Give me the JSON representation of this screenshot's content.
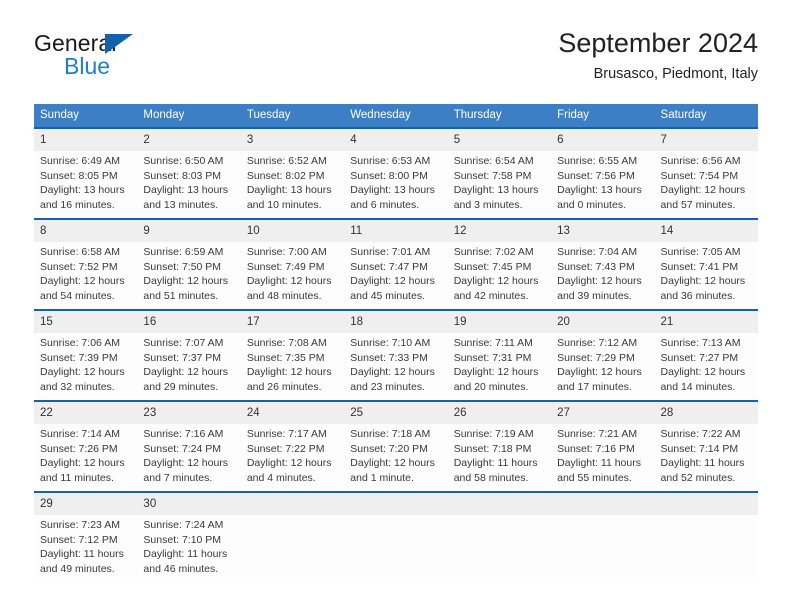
{
  "brand": {
    "name_part1": "General",
    "name_part2": "Blue",
    "triangle_color": "#1263ac",
    "blue_color": "#1a7fd4"
  },
  "header": {
    "title": "September 2024",
    "location": "Brusasco, Piedmont, Italy"
  },
  "theme": {
    "header_row_bg": "#3c7fc4",
    "week_divider": "#1263ac",
    "daynum_bg": "#efefef"
  },
  "weekdays": [
    "Sunday",
    "Monday",
    "Tuesday",
    "Wednesday",
    "Thursday",
    "Friday",
    "Saturday"
  ],
  "weeks": [
    [
      {
        "day": "1",
        "sunrise": "Sunrise: 6:49 AM",
        "sunset": "Sunset: 8:05 PM",
        "daylight1": "Daylight: 13 hours",
        "daylight2": "and 16 minutes."
      },
      {
        "day": "2",
        "sunrise": "Sunrise: 6:50 AM",
        "sunset": "Sunset: 8:03 PM",
        "daylight1": "Daylight: 13 hours",
        "daylight2": "and 13 minutes."
      },
      {
        "day": "3",
        "sunrise": "Sunrise: 6:52 AM",
        "sunset": "Sunset: 8:02 PM",
        "daylight1": "Daylight: 13 hours",
        "daylight2": "and 10 minutes."
      },
      {
        "day": "4",
        "sunrise": "Sunrise: 6:53 AM",
        "sunset": "Sunset: 8:00 PM",
        "daylight1": "Daylight: 13 hours",
        "daylight2": "and 6 minutes."
      },
      {
        "day": "5",
        "sunrise": "Sunrise: 6:54 AM",
        "sunset": "Sunset: 7:58 PM",
        "daylight1": "Daylight: 13 hours",
        "daylight2": "and 3 minutes."
      },
      {
        "day": "6",
        "sunrise": "Sunrise: 6:55 AM",
        "sunset": "Sunset: 7:56 PM",
        "daylight1": "Daylight: 13 hours",
        "daylight2": "and 0 minutes."
      },
      {
        "day": "7",
        "sunrise": "Sunrise: 6:56 AM",
        "sunset": "Sunset: 7:54 PM",
        "daylight1": "Daylight: 12 hours",
        "daylight2": "and 57 minutes."
      }
    ],
    [
      {
        "day": "8",
        "sunrise": "Sunrise: 6:58 AM",
        "sunset": "Sunset: 7:52 PM",
        "daylight1": "Daylight: 12 hours",
        "daylight2": "and 54 minutes."
      },
      {
        "day": "9",
        "sunrise": "Sunrise: 6:59 AM",
        "sunset": "Sunset: 7:50 PM",
        "daylight1": "Daylight: 12 hours",
        "daylight2": "and 51 minutes."
      },
      {
        "day": "10",
        "sunrise": "Sunrise: 7:00 AM",
        "sunset": "Sunset: 7:49 PM",
        "daylight1": "Daylight: 12 hours",
        "daylight2": "and 48 minutes."
      },
      {
        "day": "11",
        "sunrise": "Sunrise: 7:01 AM",
        "sunset": "Sunset: 7:47 PM",
        "daylight1": "Daylight: 12 hours",
        "daylight2": "and 45 minutes."
      },
      {
        "day": "12",
        "sunrise": "Sunrise: 7:02 AM",
        "sunset": "Sunset: 7:45 PM",
        "daylight1": "Daylight: 12 hours",
        "daylight2": "and 42 minutes."
      },
      {
        "day": "13",
        "sunrise": "Sunrise: 7:04 AM",
        "sunset": "Sunset: 7:43 PM",
        "daylight1": "Daylight: 12 hours",
        "daylight2": "and 39 minutes."
      },
      {
        "day": "14",
        "sunrise": "Sunrise: 7:05 AM",
        "sunset": "Sunset: 7:41 PM",
        "daylight1": "Daylight: 12 hours",
        "daylight2": "and 36 minutes."
      }
    ],
    [
      {
        "day": "15",
        "sunrise": "Sunrise: 7:06 AM",
        "sunset": "Sunset: 7:39 PM",
        "daylight1": "Daylight: 12 hours",
        "daylight2": "and 32 minutes."
      },
      {
        "day": "16",
        "sunrise": "Sunrise: 7:07 AM",
        "sunset": "Sunset: 7:37 PM",
        "daylight1": "Daylight: 12 hours",
        "daylight2": "and 29 minutes."
      },
      {
        "day": "17",
        "sunrise": "Sunrise: 7:08 AM",
        "sunset": "Sunset: 7:35 PM",
        "daylight1": "Daylight: 12 hours",
        "daylight2": "and 26 minutes."
      },
      {
        "day": "18",
        "sunrise": "Sunrise: 7:10 AM",
        "sunset": "Sunset: 7:33 PM",
        "daylight1": "Daylight: 12 hours",
        "daylight2": "and 23 minutes."
      },
      {
        "day": "19",
        "sunrise": "Sunrise: 7:11 AM",
        "sunset": "Sunset: 7:31 PM",
        "daylight1": "Daylight: 12 hours",
        "daylight2": "and 20 minutes."
      },
      {
        "day": "20",
        "sunrise": "Sunrise: 7:12 AM",
        "sunset": "Sunset: 7:29 PM",
        "daylight1": "Daylight: 12 hours",
        "daylight2": "and 17 minutes."
      },
      {
        "day": "21",
        "sunrise": "Sunrise: 7:13 AM",
        "sunset": "Sunset: 7:27 PM",
        "daylight1": "Daylight: 12 hours",
        "daylight2": "and 14 minutes."
      }
    ],
    [
      {
        "day": "22",
        "sunrise": "Sunrise: 7:14 AM",
        "sunset": "Sunset: 7:26 PM",
        "daylight1": "Daylight: 12 hours",
        "daylight2": "and 11 minutes."
      },
      {
        "day": "23",
        "sunrise": "Sunrise: 7:16 AM",
        "sunset": "Sunset: 7:24 PM",
        "daylight1": "Daylight: 12 hours",
        "daylight2": "and 7 minutes."
      },
      {
        "day": "24",
        "sunrise": "Sunrise: 7:17 AM",
        "sunset": "Sunset: 7:22 PM",
        "daylight1": "Daylight: 12 hours",
        "daylight2": "and 4 minutes."
      },
      {
        "day": "25",
        "sunrise": "Sunrise: 7:18 AM",
        "sunset": "Sunset: 7:20 PM",
        "daylight1": "Daylight: 12 hours",
        "daylight2": "and 1 minute."
      },
      {
        "day": "26",
        "sunrise": "Sunrise: 7:19 AM",
        "sunset": "Sunset: 7:18 PM",
        "daylight1": "Daylight: 11 hours",
        "daylight2": "and 58 minutes."
      },
      {
        "day": "27",
        "sunrise": "Sunrise: 7:21 AM",
        "sunset": "Sunset: 7:16 PM",
        "daylight1": "Daylight: 11 hours",
        "daylight2": "and 55 minutes."
      },
      {
        "day": "28",
        "sunrise": "Sunrise: 7:22 AM",
        "sunset": "Sunset: 7:14 PM",
        "daylight1": "Daylight: 11 hours",
        "daylight2": "and 52 minutes."
      }
    ],
    [
      {
        "day": "29",
        "sunrise": "Sunrise: 7:23 AM",
        "sunset": "Sunset: 7:12 PM",
        "daylight1": "Daylight: 11 hours",
        "daylight2": "and 49 minutes."
      },
      {
        "day": "30",
        "sunrise": "Sunrise: 7:24 AM",
        "sunset": "Sunset: 7:10 PM",
        "daylight1": "Daylight: 11 hours",
        "daylight2": "and 46 minutes."
      },
      {
        "day": "",
        "sunrise": "",
        "sunset": "",
        "daylight1": "",
        "daylight2": ""
      },
      {
        "day": "",
        "sunrise": "",
        "sunset": "",
        "daylight1": "",
        "daylight2": ""
      },
      {
        "day": "",
        "sunrise": "",
        "sunset": "",
        "daylight1": "",
        "daylight2": ""
      },
      {
        "day": "",
        "sunrise": "",
        "sunset": "",
        "daylight1": "",
        "daylight2": ""
      },
      {
        "day": "",
        "sunrise": "",
        "sunset": "",
        "daylight1": "",
        "daylight2": ""
      }
    ]
  ]
}
